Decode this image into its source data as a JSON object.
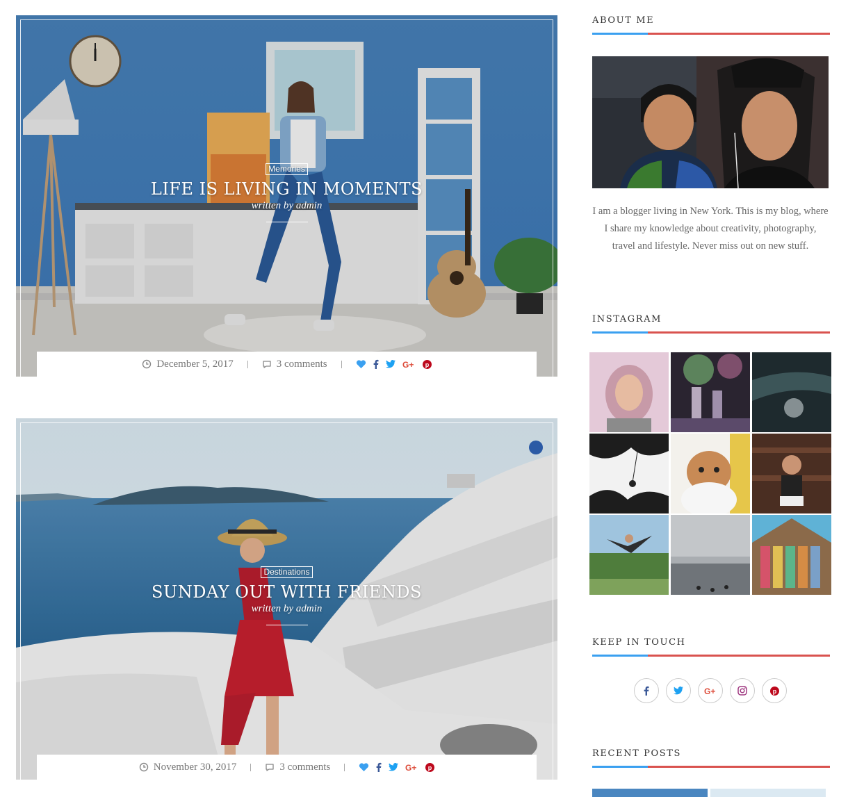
{
  "posts": [
    {
      "category": "Memories",
      "title": "LIFE IS LIVING IN MOMENTS",
      "author": "written by admin",
      "date": "December 5, 2017",
      "comments": "3 comments",
      "share_icons": [
        "heart-icon",
        "facebook-icon",
        "twitter-icon",
        "google-plus-icon",
        "pinterest-icon"
      ]
    },
    {
      "category": "Destinations",
      "title": "SUNDAY OUT WITH FRIENDS",
      "author": "written by admin",
      "date": "November 30, 2017",
      "comments": "3 comments",
      "share_icons": [
        "heart-icon",
        "facebook-icon",
        "twitter-icon",
        "google-plus-icon",
        "pinterest-icon"
      ]
    }
  ],
  "sidebar": {
    "about": {
      "title": "ABOUT ME",
      "text": "I am a blogger living in New York. This is my blog, where I share my knowledge about creativity, photography, travel and lifestyle. Never miss out on new stuff."
    },
    "instagram": {
      "title": "INSTAGRAM"
    },
    "keep_in_touch": {
      "title": "KEEP IN TOUCH",
      "icons": [
        "facebook-icon",
        "twitter-icon",
        "google-plus-icon",
        "instagram-icon",
        "pinterest-icon"
      ]
    },
    "recent_posts": {
      "title": "RECENT POSTS"
    }
  },
  "colors": {
    "accent_blue": "#3aa0f0",
    "accent_red": "#d9534f",
    "heart": "#3aa0f0",
    "facebook": "#3b5998",
    "twitter": "#1da1f2",
    "google_plus": "#dd4b39",
    "pinterest": "#bd081c"
  }
}
